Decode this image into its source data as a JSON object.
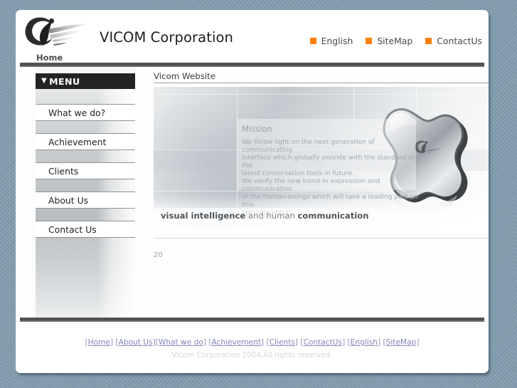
{
  "header": {
    "logo_icon": "vicom-swoosh-logo",
    "brand_title": "VICOM Corporation",
    "home_label": "Home",
    "nav": [
      {
        "label": "English",
        "bullet_icon": "orange-square-bullet"
      },
      {
        "label": "SiteMap",
        "bullet_icon": "orange-square-bullet"
      },
      {
        "label": "ContactUs",
        "bullet_icon": "orange-square-bullet"
      }
    ]
  },
  "sidebar": {
    "menu_caret_icon": "caret-down-icon",
    "menu_title": "MENU",
    "items": [
      {
        "label": "What we do?"
      },
      {
        "label": "Achievement"
      },
      {
        "label": "Clients"
      },
      {
        "label": "About Us"
      },
      {
        "label": "Contact Us"
      }
    ]
  },
  "main": {
    "content_title": "Vicom Website",
    "hero": {
      "mission_heading": "Mission",
      "mission_body": "We throw light on the next generation of communicating\ninterface which globally provide with the standard of the\nlatest conversation tools in future.\nWe verify the new trend in expression and communication\nof the human-beings which will take a leading part on this\ncoming century.",
      "tagline_part1": "visual intelligence",
      "tagline_part2": " and human ",
      "tagline_part3": "communication",
      "graphic_icon": "metallic-blob-logo-graphic"
    },
    "counter": "20"
  },
  "footer": {
    "links": [
      "Home",
      "About Us",
      "What we do",
      "Achievement",
      "Clients",
      "ContactUs",
      "English",
      "SiteMap"
    ],
    "bracket_open": "[",
    "bracket_close": "]",
    "copyright": "Vicom Corporation 2004,All rights reserved."
  },
  "colors": {
    "accent_orange": "#ff7f00",
    "menu_header_bg": "#232323",
    "page_bg": "#7d99ab",
    "footer_link": "#8386bb"
  }
}
